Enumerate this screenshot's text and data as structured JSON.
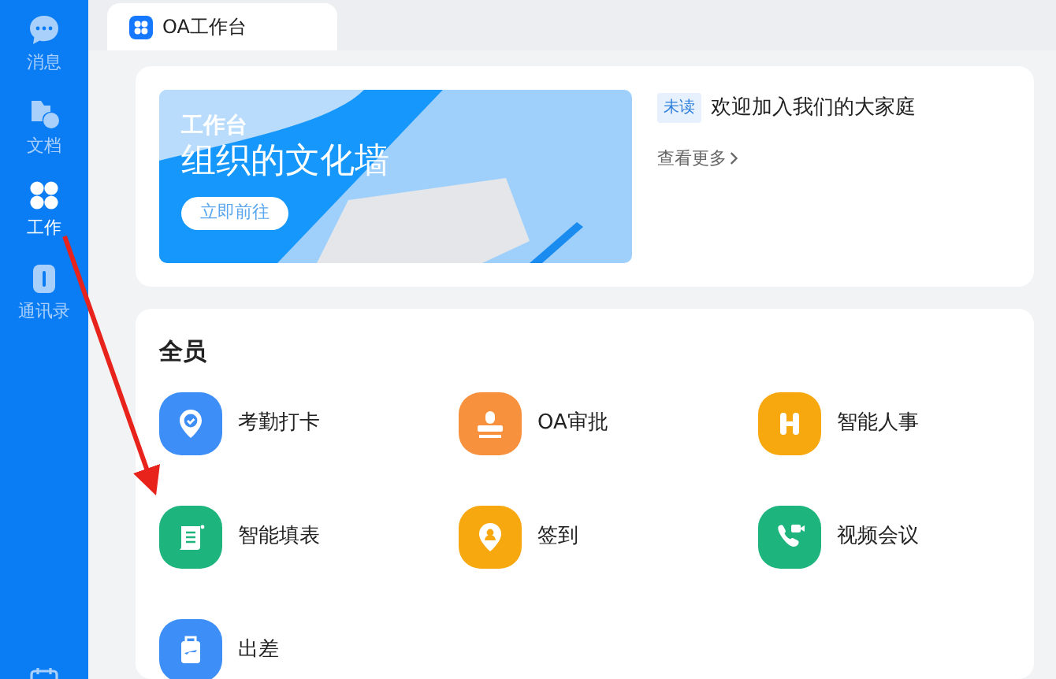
{
  "sidebar": {
    "items": [
      {
        "label": "消息",
        "selected": false
      },
      {
        "label": "文档",
        "selected": false
      },
      {
        "label": "工作",
        "selected": true
      },
      {
        "label": "通讯录",
        "selected": false
      }
    ]
  },
  "tabs": [
    {
      "label": "OA工作台",
      "selected": true
    }
  ],
  "banner": {
    "subtitle": "工作台",
    "title": "组织的文化墙",
    "button": "立即前往"
  },
  "notice": {
    "badge": "未读",
    "text": "欢迎加入我们的大家庭",
    "more": "查看更多"
  },
  "section": {
    "title": "全员",
    "apps": [
      {
        "label": "考勤打卡",
        "color": "#3d8ef7"
      },
      {
        "label": "OA审批",
        "color": "#f7913d"
      },
      {
        "label": "智能人事",
        "color": "#f8a80f"
      },
      {
        "label": "智能填表",
        "color": "#1eb47d"
      },
      {
        "label": "签到",
        "color": "#f8a80f"
      },
      {
        "label": "视频会议",
        "color": "#1eb47d"
      },
      {
        "label": "出差",
        "color": "#3d8ef7"
      }
    ]
  }
}
